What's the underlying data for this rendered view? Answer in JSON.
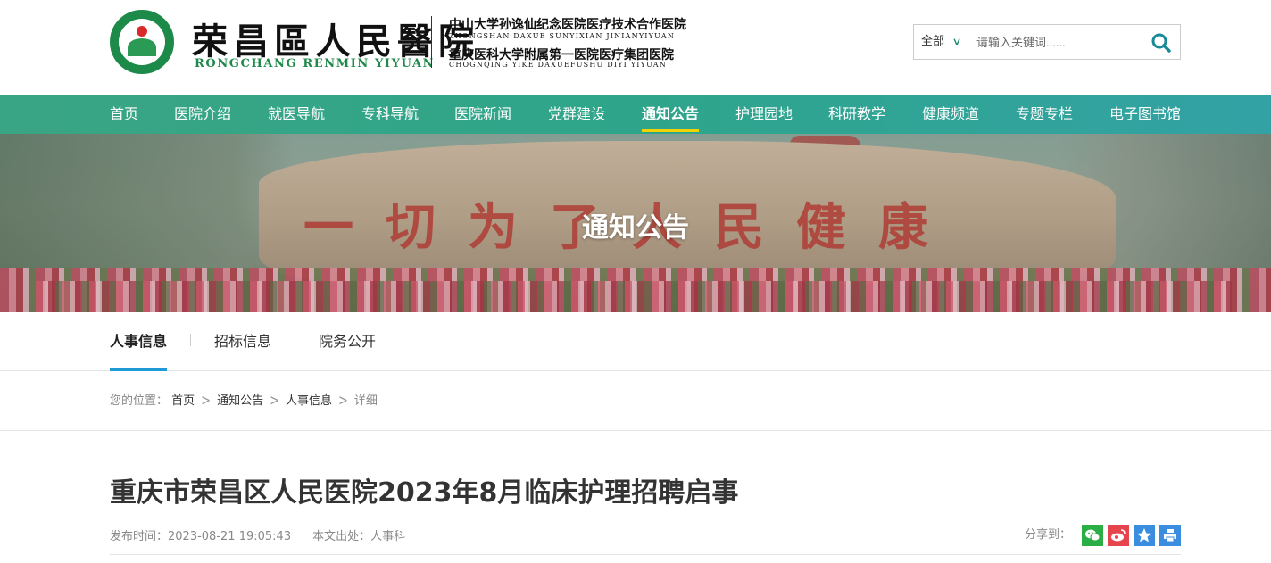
{
  "header": {
    "logo_cn": "荣昌區人民醫院",
    "logo_en": "RONGCHANG RENMIN YIYUAN",
    "affiliation1_cn": "中山大学孙逸仙纪念医院医疗技术合作医院",
    "affiliation1_en": "ZHONGSHAN DAXUE SUNYIXIAN JINIANYIYUAN",
    "affiliation2_cn": "重庆医科大学附属第一医院医疗集团医院",
    "affiliation2_en": "CHOGNQING YIKE DAXUEFUSHU DIYI YIYUAN",
    "search": {
      "scope": "全部",
      "placeholder": "请输入关键词......",
      "icon": "search-icon"
    }
  },
  "nav": {
    "items": [
      {
        "label": "首页"
      },
      {
        "label": "医院介绍"
      },
      {
        "label": "就医导航"
      },
      {
        "label": "专科导航"
      },
      {
        "label": "医院新闻"
      },
      {
        "label": "党群建设"
      },
      {
        "label": "通知公告",
        "active": true
      },
      {
        "label": "护理园地"
      },
      {
        "label": "科研教学"
      },
      {
        "label": "健康频道"
      },
      {
        "label": "专题专栏"
      },
      {
        "label": "电子图书馆"
      }
    ]
  },
  "banner": {
    "title": "通知公告",
    "rock_inscription": "一切为了人民健康"
  },
  "subnav": {
    "items": [
      {
        "label": "人事信息",
        "active": true
      },
      {
        "label": "招标信息"
      },
      {
        "label": "院务公开"
      }
    ]
  },
  "breadcrumb": {
    "label": "您的位置：",
    "items": [
      "首页",
      "通知公告",
      "人事信息",
      "详细"
    ]
  },
  "article": {
    "title": "重庆市荣昌区人民医院2023年8月临床护理招聘启事",
    "publish_label": "发布时间：",
    "publish_time": "2023-08-21 19:05:43",
    "source_label": "本文出处：",
    "source": "人事科"
  },
  "share": {
    "label": "分享到：",
    "buttons": [
      {
        "name": "wechat-icon",
        "color": "#2aae45"
      },
      {
        "name": "weibo-icon",
        "color": "#e6454d"
      },
      {
        "name": "qzone-icon",
        "color": "#3b8de0"
      },
      {
        "name": "print-icon",
        "color": "#3b8de0"
      }
    ]
  },
  "colors": {
    "nav_start": "#3aa584",
    "nav_end": "#33a2a5",
    "nav_active_underline": "#f2d200",
    "subnav_active_underline": "#1e9bd7",
    "brand_green": "#1e8a4a"
  }
}
